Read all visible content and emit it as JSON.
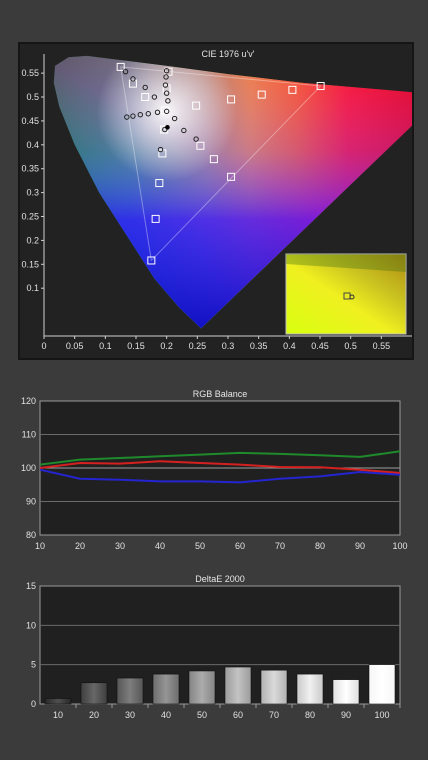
{
  "charts": {
    "cie": {
      "title": "CIE 1976 u'v'",
      "x_ticks": [
        "0",
        "0.05",
        "0.1",
        "0.15",
        "0.2",
        "0.25",
        "0.3",
        "0.35",
        "0.4",
        "0.45",
        "0.5",
        "0.55"
      ],
      "y_ticks": [
        "0.1",
        "0.15",
        "0.2",
        "0.25",
        "0.3",
        "0.35",
        "0.4",
        "0.45",
        "0.5",
        "0.55"
      ]
    },
    "rgb": {
      "title": "RGB Balance",
      "x_ticks": [
        "10",
        "20",
        "30",
        "40",
        "50",
        "60",
        "70",
        "80",
        "90",
        "100"
      ],
      "y_ticks": [
        "80",
        "90",
        "100",
        "110",
        "120"
      ]
    },
    "de": {
      "title": "DeltaE 2000",
      "x_ticks": [
        "10",
        "20",
        "30",
        "40",
        "50",
        "60",
        "70",
        "80",
        "90",
        "100"
      ],
      "y_ticks": [
        "0",
        "5",
        "10",
        "15"
      ]
    }
  },
  "chart_data": [
    {
      "type": "scatter",
      "title": "CIE 1976 u'v'",
      "xlim": [
        0,
        0.6
      ],
      "ylim": [
        0,
        0.59
      ],
      "gamut_triangle": [
        [
          0.451,
          0.523
        ],
        [
          0.125,
          0.563
        ],
        [
          0.175,
          0.158
        ]
      ],
      "white_point": [
        0.198,
        0.468
      ],
      "targets": [
        [
          0.451,
          0.523
        ],
        [
          0.405,
          0.515
        ],
        [
          0.355,
          0.505
        ],
        [
          0.305,
          0.495
        ],
        [
          0.248,
          0.482
        ],
        [
          0.125,
          0.563
        ],
        [
          0.145,
          0.528
        ],
        [
          0.165,
          0.5
        ],
        [
          0.175,
          0.158
        ],
        [
          0.182,
          0.245
        ],
        [
          0.188,
          0.32
        ],
        [
          0.193,
          0.382
        ],
        [
          0.305,
          0.333
        ],
        [
          0.277,
          0.37
        ],
        [
          0.255,
          0.398
        ],
        [
          0.203,
          0.553
        ],
        [
          0.2,
          0.518
        ],
        [
          0.197,
          0.472
        ],
        [
          0.196,
          0.432
        ]
      ],
      "measured": [
        [
          0.133,
          0.553
        ],
        [
          0.145,
          0.538
        ],
        [
          0.165,
          0.52
        ],
        [
          0.18,
          0.5
        ],
        [
          0.2,
          0.47
        ],
        [
          0.2,
          0.555
        ],
        [
          0.199,
          0.542
        ],
        [
          0.198,
          0.525
        ],
        [
          0.2,
          0.508
        ],
        [
          0.202,
          0.492
        ],
        [
          0.135,
          0.458
        ],
        [
          0.145,
          0.46
        ],
        [
          0.157,
          0.463
        ],
        [
          0.17,
          0.465
        ],
        [
          0.185,
          0.468
        ],
        [
          0.213,
          0.455
        ],
        [
          0.228,
          0.43
        ],
        [
          0.248,
          0.412
        ],
        [
          0.197,
          0.432
        ],
        [
          0.19,
          0.39
        ]
      ],
      "inset_label": "zoom"
    },
    {
      "type": "line",
      "title": "RGB Balance",
      "x": [
        10,
        20,
        30,
        40,
        50,
        60,
        70,
        80,
        90,
        100
      ],
      "ylim": [
        80,
        120
      ],
      "series": [
        {
          "color": "#1f8a2c",
          "values": [
            101,
            102.5,
            103,
            103.5,
            104,
            104.5,
            104.2,
            103.8,
            103.3,
            105
          ]
        },
        {
          "color": "#d52020",
          "values": [
            100,
            101.5,
            101.3,
            102,
            101.5,
            101,
            100.3,
            100.2,
            99.5,
            98.5
          ]
        },
        {
          "color": "#2424d0",
          "values": [
            99.5,
            96.8,
            96.5,
            96,
            96,
            95.7,
            96.8,
            97.5,
            98.8,
            98
          ]
        }
      ]
    },
    {
      "type": "bar",
      "title": "DeltaE 2000",
      "categories": [
        "10",
        "20",
        "30",
        "40",
        "50",
        "60",
        "70",
        "80",
        "90",
        "100"
      ],
      "values": [
        0.7,
        2.7,
        3.3,
        3.8,
        4.2,
        4.7,
        4.3,
        3.8,
        3.1,
        5.0
      ],
      "ylim": [
        0,
        15
      ]
    }
  ]
}
